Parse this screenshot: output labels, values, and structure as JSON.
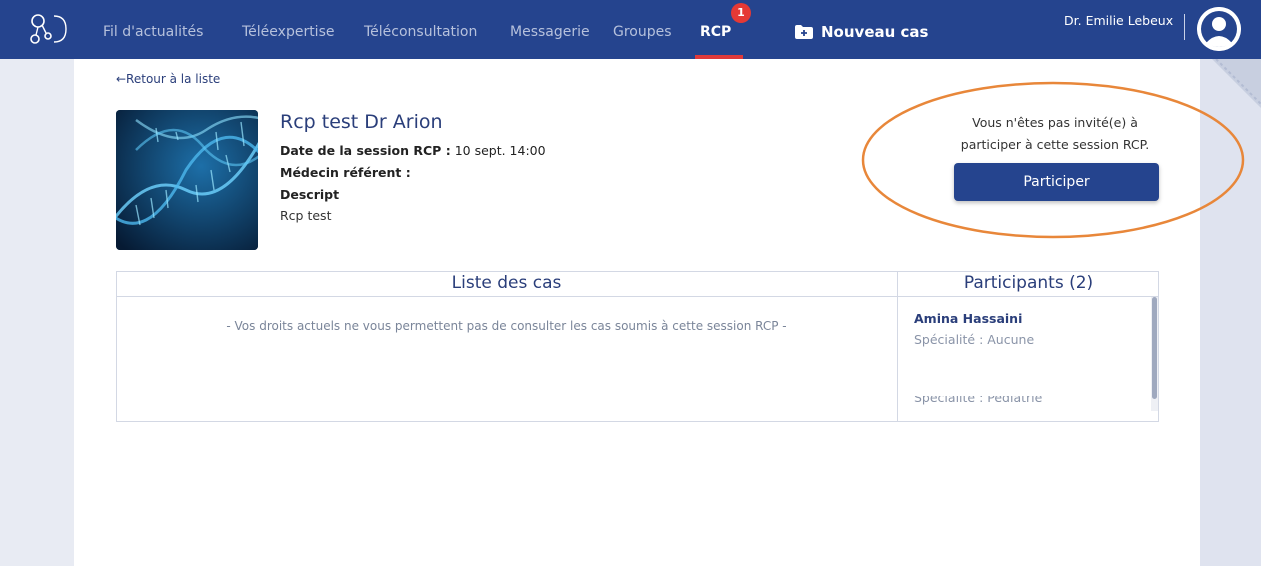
{
  "nav": {
    "items": [
      {
        "label": "Fil d'actualités"
      },
      {
        "label": "Téléexpertise"
      },
      {
        "label": "Téléconsultation"
      },
      {
        "label": "Messagerie"
      },
      {
        "label": "Groupes"
      },
      {
        "label": "RCP",
        "active": true,
        "badge": "1"
      }
    ],
    "new_case_label": "Nouveau cas",
    "user_name": "Dr. Emilie Lebeux",
    "icons": [
      "logo-icon",
      "folder-plus-icon",
      "avatar-icon"
    ]
  },
  "page": {
    "back_label": "←Retour à la liste",
    "title": "Rcp test Dr Arion",
    "date_label": "Date de la session RCP :",
    "date_value": "10 sept. 14:00",
    "referent_label": "Médecin référent :",
    "description_label": "Descript",
    "description_value": "Rcp test"
  },
  "invite": {
    "message": "Vous n'êtes pas invité(e) à participer à cette session RCP.",
    "button_label": "Participer"
  },
  "cases": {
    "header": "Liste des cas",
    "empty_message": "- Vos droits actuels ne vous permettent pas de consulter les cas soumis à cette session RCP -"
  },
  "participants": {
    "header": "Participants (2)",
    "items": [
      {
        "name": "Amina Hassaini",
        "specialty": "Spécialité : Aucune"
      },
      {
        "name": "",
        "specialty": "Spécialité : Pédiatrie"
      }
    ]
  },
  "colors": {
    "brand": "#25448e",
    "badge": "#e53935",
    "highlight": "#e8873a"
  }
}
